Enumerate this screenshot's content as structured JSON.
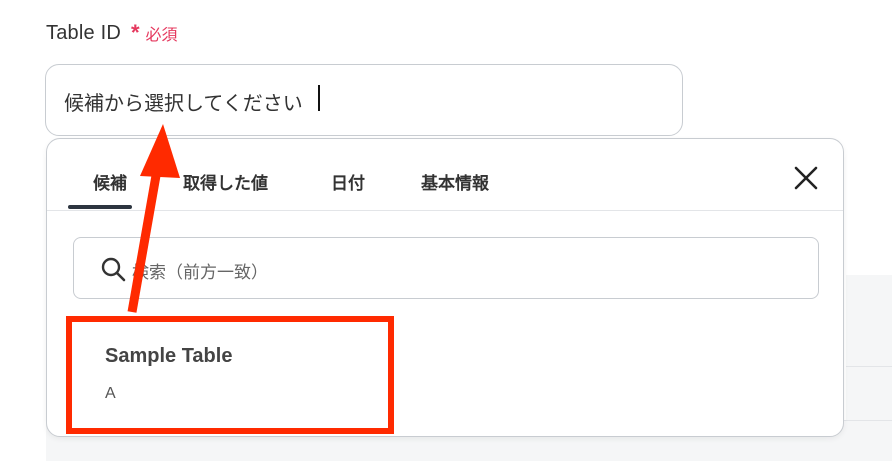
{
  "field": {
    "label": "Table ID",
    "required_mark": "*",
    "required_text": "必須",
    "value": "候補から選択してください"
  },
  "dropdown": {
    "tabs": [
      {
        "label": "候補",
        "active": true
      },
      {
        "label": "取得した値",
        "active": false
      },
      {
        "label": "日付",
        "active": false
      },
      {
        "label": "基本情報",
        "active": false
      }
    ],
    "close_icon": "close-icon",
    "search": {
      "icon": "search-icon",
      "placeholder": "検索（前方一致）"
    },
    "options": [
      {
        "title": "Sample Table",
        "subtitle": "A"
      }
    ]
  },
  "colors": {
    "required": "#e5385e",
    "annotation": "#ff2a00",
    "tab_underline": "#2d3540"
  }
}
